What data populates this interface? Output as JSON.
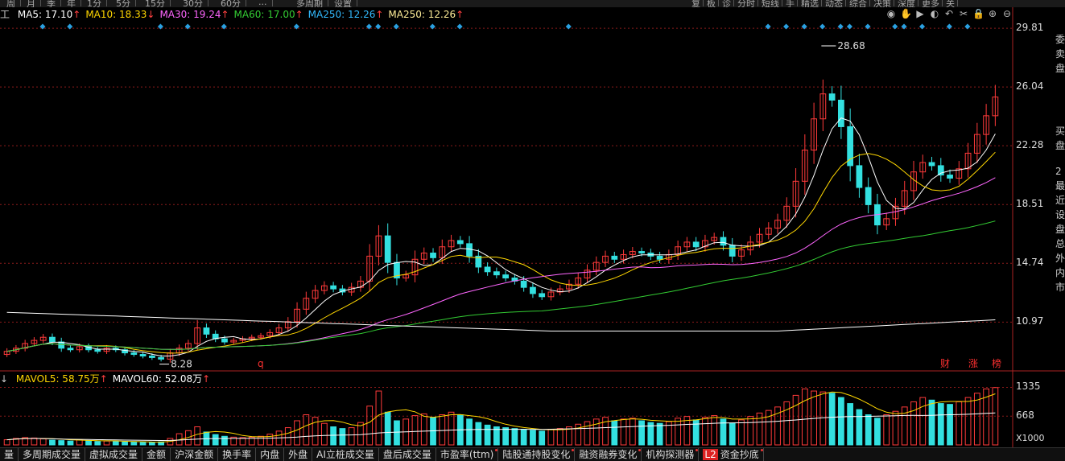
{
  "toolbar": {
    "segments": [
      "周",
      "月",
      "季",
      "年",
      "1分",
      "5分",
      "15分",
      "30分",
      "60分",
      "...",
      "多周期",
      "设置"
    ],
    "right_segments": [
      "复",
      "板",
      "诊",
      "分时",
      "短线",
      "手",
      "精选",
      "动态",
      "综合",
      "决策",
      "深度",
      "更多",
      "关"
    ]
  },
  "ma_legend": [
    {
      "label": "MA5: 17.10",
      "arrow": "↑",
      "color": "#ffffff"
    },
    {
      "label": "MA10: 18.33",
      "arrow": "↓",
      "color": "#ffd700"
    },
    {
      "label": "MA30: 19.24",
      "arrow": "↑",
      "color": "#ff66ff"
    },
    {
      "label": "MA60: 17.00",
      "arrow": "↑",
      "color": "#33cc33"
    },
    {
      "label": "MA250: 12.26",
      "arrow": "↑",
      "color": "#33bbff"
    },
    {
      "label": "MA250: 12.26",
      "arrow": "↑",
      "color": "#ffee99"
    }
  ],
  "tool_icons": [
    "eye-icon",
    "hand-icon",
    "play-icon",
    "back-icon",
    "undo-icon",
    "scissors-icon",
    "lock-icon",
    "zoom-in-icon",
    "zoom-out-icon"
  ],
  "price_axis": [
    "29.81",
    "26.04",
    "22.28",
    "18.51",
    "14.74",
    "10.97"
  ],
  "volume_axis": [
    "1335",
    "668"
  ],
  "volume_unit": "X1000",
  "volume_legend": [
    {
      "label": "MAVOL5: 58.75万",
      "arrow": "↑",
      "color": "#ffd700"
    },
    {
      "label": "MAVOL60: 52.08万",
      "arrow": "↑",
      "color": "#ffffff"
    }
  ],
  "annotations": {
    "high": "28.68",
    "low": "8.28",
    "marker_q": "q"
  },
  "event_markers": [
    "财",
    "涨",
    "榜"
  ],
  "right_panel": [
    "委",
    "卖",
    "盘",
    "买",
    "盘",
    "2",
    "最",
    "近",
    "设",
    "盘",
    "总",
    "外",
    "内",
    "市"
  ],
  "bottom_tabs": [
    {
      "label": "量",
      "dot": false
    },
    {
      "label": "多周期成交量",
      "dot": false
    },
    {
      "label": "虚拟成交量",
      "dot": false
    },
    {
      "label": "金额",
      "dot": false
    },
    {
      "label": "沪深金额",
      "dot": false
    },
    {
      "label": "换手率",
      "dot": false
    },
    {
      "label": "内盘",
      "dot": false
    },
    {
      "label": "外盘",
      "dot": false
    },
    {
      "label": "AI立桩成交量",
      "dot": false
    },
    {
      "label": "盘后成交量",
      "dot": false
    },
    {
      "label": "市盈率(ttm)",
      "dot": true
    },
    {
      "label": "陆股通持股变化",
      "dot": true
    },
    {
      "label": "融资融券变化",
      "dot": true
    },
    {
      "label": "机构探测器",
      "dot": true
    },
    {
      "label": "资金抄底",
      "dot": true,
      "badge": "L2"
    }
  ],
  "colors": {
    "up": "#ff3a3a",
    "down": "#33e0e0",
    "ma5": "#ffffff",
    "ma10": "#ffd700",
    "ma30": "#ff66ff",
    "ma60": "#33cc33",
    "ma250": "#ffffff",
    "grid": "#8a1a1a"
  },
  "chart_data": {
    "type": "candlestick",
    "ylim": [
      8.0,
      31.0
    ],
    "yticks": [
      29.81,
      26.04,
      22.28,
      18.51,
      14.74,
      10.97
    ],
    "high_label": 28.68,
    "low_label": 8.28,
    "closes": [
      9.1,
      9.3,
      9.6,
      9.8,
      10.0,
      9.7,
      9.3,
      9.2,
      9.4,
      9.2,
      9.1,
      9.3,
      9.2,
      9.0,
      8.9,
      8.8,
      8.7,
      8.6,
      9.0,
      9.3,
      9.6,
      10.6,
      10.2,
      9.9,
      9.7,
      9.8,
      9.9,
      10.0,
      10.1,
      10.3,
      10.6,
      11.0,
      11.8,
      12.5,
      13.0,
      13.3,
      13.1,
      12.9,
      13.2,
      13.6,
      15.2,
      16.5,
      14.8,
      13.8,
      14.0,
      15.0,
      15.4,
      15.1,
      15.8,
      16.2,
      16.0,
      15.2,
      14.5,
      14.2,
      14.0,
      13.8,
      13.6,
      13.2,
      12.8,
      12.6,
      12.9,
      13.1,
      13.4,
      13.8,
      14.3,
      14.8,
      15.2,
      15.0,
      15.3,
      15.5,
      15.4,
      15.2,
      15.0,
      15.3,
      15.8,
      16.1,
      15.8,
      16.2,
      16.4,
      15.9,
      15.2,
      15.6,
      16.1,
      16.6,
      17.0,
      17.5,
      18.4,
      20.0,
      22.0,
      24.0,
      25.6,
      25.2,
      23.5,
      21.0,
      19.6,
      18.5,
      17.2,
      17.6,
      18.4,
      19.4,
      20.6,
      21.2,
      21.0,
      20.4,
      20.2,
      20.8,
      21.8,
      23.0,
      24.2,
      25.4
    ],
    "ma5_last": 17.1,
    "ma10_last": 18.33,
    "ma30_last": 19.24,
    "ma60_last": 17.0,
    "ma250_last": 12.26,
    "volume_ylim": [
      0,
      1400
    ],
    "volumes": [
      120,
      150,
      170,
      160,
      140,
      110,
      100,
      90,
      120,
      100,
      80,
      90,
      80,
      70,
      70,
      60,
      60,
      70,
      150,
      260,
      330,
      420,
      300,
      240,
      200,
      180,
      170,
      180,
      200,
      250,
      320,
      400,
      560,
      700,
      640,
      500,
      420,
      380,
      400,
      520,
      900,
      1250,
      760,
      560,
      600,
      680,
      720,
      640,
      700,
      760,
      700,
      600,
      520,
      460,
      420,
      400,
      380,
      360,
      340,
      320,
      360,
      380,
      420,
      480,
      540,
      600,
      640,
      560,
      600,
      620,
      560,
      520,
      500,
      540,
      620,
      660,
      580,
      640,
      680,
      600,
      500,
      580,
      660,
      740,
      800,
      880,
      1000,
      1150,
      1300,
      1250,
      1230,
      1200,
      1100,
      960,
      820,
      700,
      620,
      700,
      780,
      880,
      1000,
      1100,
      1040,
      960,
      940,
      1000,
      1100,
      1200,
      1300,
      1330
    ]
  }
}
